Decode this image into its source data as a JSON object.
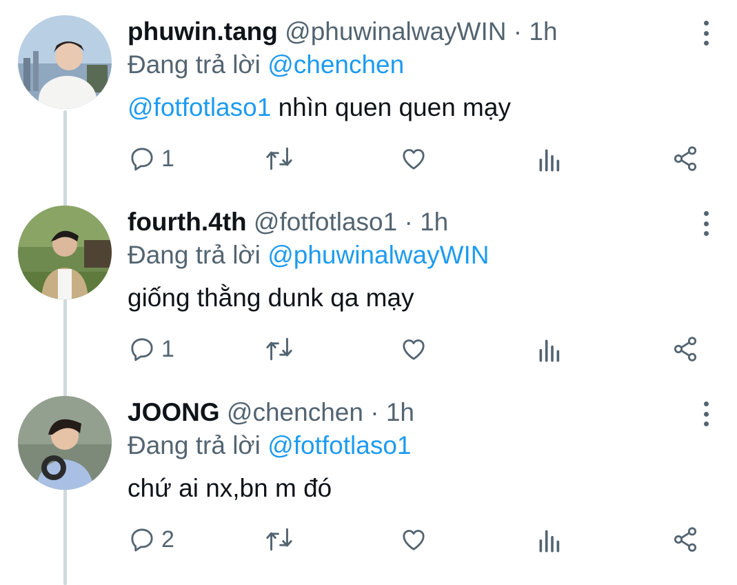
{
  "tweets": [
    {
      "name": "phuwin.tang",
      "handle": "@phuwinalwayWIN",
      "dot": " · ",
      "time": "1h",
      "reply_prefix": "Đang trả lời ",
      "reply_to": "@chenchen",
      "body_mention": "@fotfotlaso1",
      "body_text": " nhìn quen quen mạy",
      "reply_count": "1"
    },
    {
      "name": "fourth.4th",
      "handle": "@fotfotlaso1",
      "dot": " · ",
      "time": "1h",
      "reply_prefix": "Đang trả lời ",
      "reply_to": "@phuwinalwayWIN",
      "body_mention": "",
      "body_text": "giống thằng dunk qa mạy",
      "reply_count": "1"
    },
    {
      "name": "JOONG",
      "handle": "@chenchen",
      "dot": " · ",
      "time": "1h",
      "reply_prefix": "Đang trả lời ",
      "reply_to": "@fotfotlaso1",
      "body_mention": "",
      "body_text": "chứ ai nx,bn m đó",
      "reply_count": "2"
    }
  ],
  "icons": {
    "reply": "reply-icon",
    "retweet": "retweet-icon",
    "like": "heart-icon",
    "views": "analytics-icon",
    "share": "share-icon",
    "more": "more-vertical-icon"
  },
  "colors": {
    "mention": "#1d9bf0",
    "secondary": "#536471",
    "text": "#0f1419",
    "thread_line": "#cfd9de"
  }
}
